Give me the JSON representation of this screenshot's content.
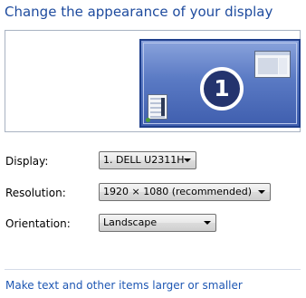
{
  "title": "Change the appearance of your display",
  "preview": {
    "monitor_number": "1"
  },
  "display": {
    "label": "Display:",
    "value": "1. DELL U2311H"
  },
  "resolution": {
    "label": "Resolution:",
    "value": "1920 × 1080 (recommended)"
  },
  "orientation": {
    "label": "Orientation:",
    "value": "Landscape"
  },
  "link": {
    "label": "Make text and other items larger or smaller"
  },
  "colors": {
    "title_blue": "#1e4b9e",
    "link_blue": "#1e57b3",
    "monitor_blue": "#5a7ac4"
  }
}
